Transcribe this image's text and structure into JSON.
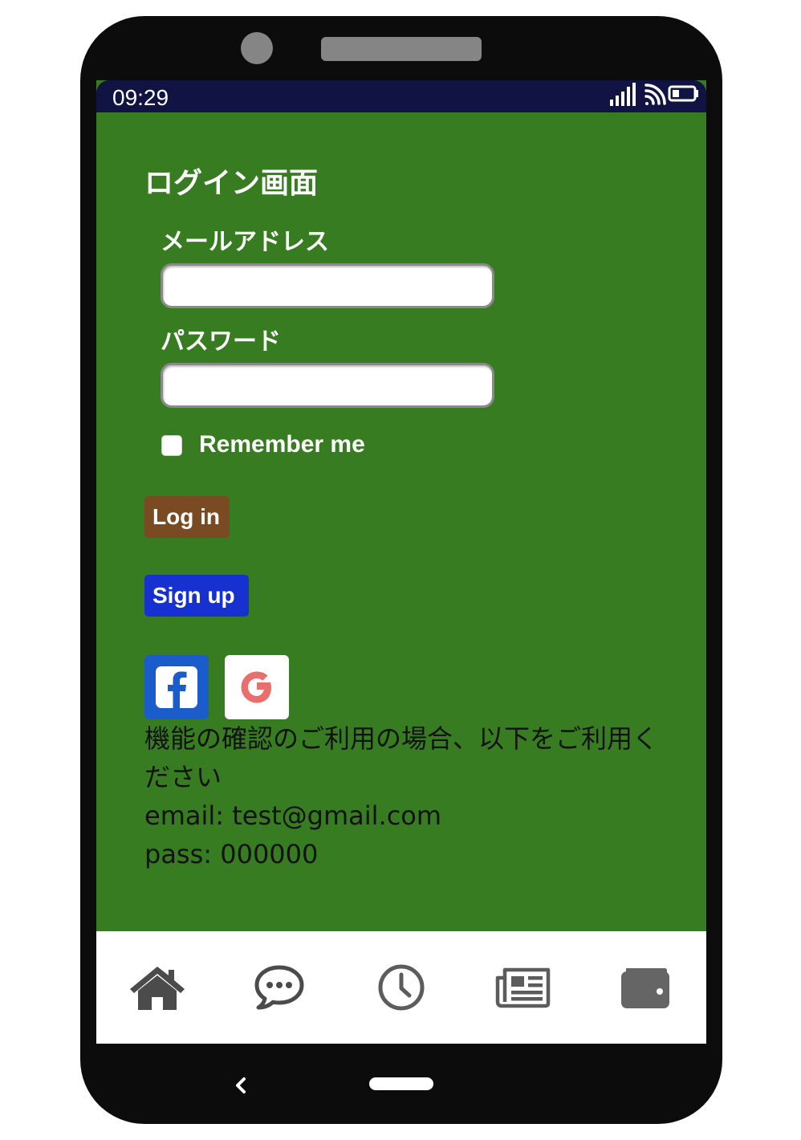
{
  "status_bar": {
    "time": "09:29",
    "icons": [
      "signal-icon",
      "cast-icon",
      "battery-icon"
    ]
  },
  "login": {
    "title": "ログイン画面",
    "email_label": "メールアドレス",
    "email_value": "",
    "password_label": "パスワード",
    "password_value": "",
    "remember_label": "Remember me",
    "remember_checked": false,
    "login_button": "Log in",
    "signup_button": "Sign up"
  },
  "social": {
    "icons": [
      "facebook-icon",
      "google-icon"
    ]
  },
  "info": {
    "line1": "機能の確認のご利用の場合、以下をご利用く",
    "line2": "ださい",
    "email_line": "email: test@gmail.com",
    "pass_line": "pass: 000000"
  },
  "tabbar": {
    "items": [
      "home-icon",
      "chat-icon",
      "clock-icon",
      "newspaper-icon",
      "wallet-icon"
    ]
  },
  "colors": {
    "screen_bg": "#387c22",
    "status_bg": "#111442",
    "login_button": "#7a4a22",
    "signup_button": "#1730d0",
    "facebook": "#1a5cc9",
    "google": "#e86f6c",
    "tab_icon": "#5a5a5a"
  }
}
